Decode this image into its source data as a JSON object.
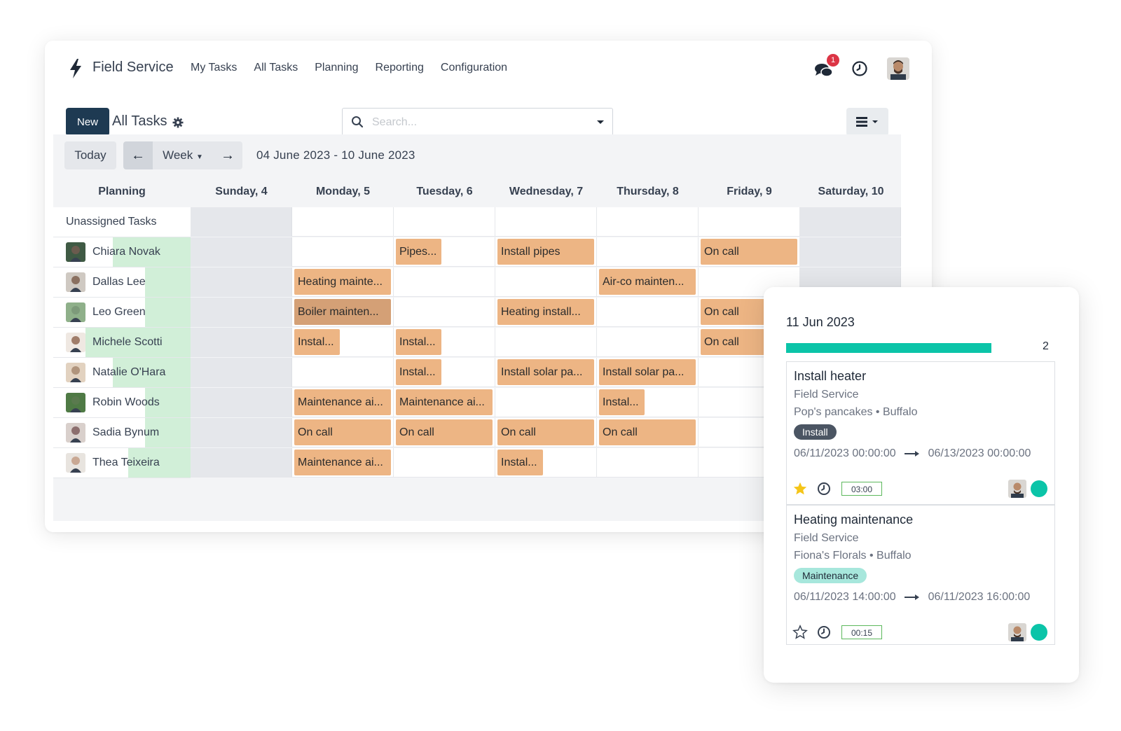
{
  "navbar": {
    "app_name": "Field Service",
    "menu": [
      "My Tasks",
      "All Tasks",
      "Planning",
      "Reporting",
      "Configuration"
    ],
    "chat_badge": "1",
    "icons": [
      "bolt-icon",
      "chat-icon",
      "clock-icon",
      "user-avatar"
    ]
  },
  "control": {
    "new_label": "New",
    "title": "All Tasks",
    "search_placeholder": "Search..."
  },
  "toolbar": {
    "today_label": "Today",
    "prev_label": "←",
    "scale_label": "Week",
    "next_label": "→",
    "date_range": "04 June 2023 - 10 June 2023"
  },
  "gantt": {
    "header": [
      "Planning",
      "Sunday, 4",
      "Monday, 5",
      "Tuesday, 6",
      "Wednesday, 7",
      "Thursday, 8",
      "Friday, 9",
      "Saturday, 10"
    ],
    "rows": [
      {
        "name": "Unassigned Tasks",
        "avatar": false,
        "green_fraction": 0,
        "tasks": []
      },
      {
        "name": "Chiara Novak",
        "avatar": true,
        "green_fraction": 0.65,
        "tasks": [
          {
            "day": 2,
            "span": 0.47,
            "label": "Pipes..."
          },
          {
            "day": 3,
            "span": 0.97,
            "label": "Install pipes"
          },
          {
            "day": 5,
            "span": 0.97,
            "label": "On call"
          }
        ]
      },
      {
        "name": "Dallas Lee",
        "avatar": true,
        "green_fraction": 0.38,
        "tasks": [
          {
            "day": 1,
            "span": 0.97,
            "label": "Heating mainte..."
          },
          {
            "day": 4,
            "span": 0.97,
            "label": "Air-co mainten..."
          }
        ]
      },
      {
        "name": "Leo Green",
        "avatar": true,
        "green_fraction": 0.38,
        "tasks": [
          {
            "day": 1,
            "span": 0.97,
            "label": "Boiler mainten...",
            "dark": true
          },
          {
            "day": 3,
            "span": 0.97,
            "label": "Heating install..."
          },
          {
            "day": 5,
            "span": 0.97,
            "label": "On call"
          }
        ]
      },
      {
        "name": "Michele Scotti",
        "avatar": true,
        "green_fraction": 0.88,
        "tasks": [
          {
            "day": 1,
            "span": 0.47,
            "label": "Instal..."
          },
          {
            "day": 2,
            "span": 0.47,
            "label": "Instal..."
          },
          {
            "day": 5,
            "span": 0.97,
            "label": "On call"
          }
        ]
      },
      {
        "name": "Natalie O'Hara",
        "avatar": true,
        "green_fraction": 0.65,
        "tasks": [
          {
            "day": 2,
            "span": 0.47,
            "label": "Instal..."
          },
          {
            "day": 3,
            "span": 0.97,
            "label": "Install solar pa..."
          },
          {
            "day": 4,
            "span": 0.97,
            "label": "Install solar pa..."
          }
        ]
      },
      {
        "name": "Robin Woods",
        "avatar": true,
        "green_fraction": 0.38,
        "tasks": [
          {
            "day": 1,
            "span": 0.97,
            "label": "Maintenance ai..."
          },
          {
            "day": 2,
            "span": 0.97,
            "label": "Maintenance ai..."
          },
          {
            "day": 4,
            "span": 0.47,
            "label": "Instal..."
          }
        ]
      },
      {
        "name": "Sadia Bynum",
        "avatar": true,
        "green_fraction": 0.38,
        "tasks": [
          {
            "day": 1,
            "span": 0.97,
            "label": "On call"
          },
          {
            "day": 2,
            "span": 0.97,
            "label": "On call"
          },
          {
            "day": 3,
            "span": 0.97,
            "label": "On call"
          },
          {
            "day": 4,
            "span": 0.97,
            "label": "On call"
          }
        ]
      },
      {
        "name": "Thea Teixeira",
        "avatar": true,
        "green_fraction": 0.52,
        "tasks": [
          {
            "day": 1,
            "span": 0.97,
            "label": "Maintenance ai..."
          },
          {
            "day": 3,
            "span": 0.47,
            "label": "Instal..."
          }
        ]
      }
    ]
  },
  "popover": {
    "date": "11 Jun 2023",
    "count": "2",
    "progress_fraction": 0.75,
    "cards": [
      {
        "title": "Install heater",
        "project": "Field Service",
        "location": "Pop's pancakes • Buffalo",
        "tag": "Install",
        "tag_style": "dark",
        "start": "06/11/2023 00:00:00",
        "end": "06/13/2023 00:00:00",
        "starred": true,
        "duration": "03:00"
      },
      {
        "title": "Heating maintenance",
        "project": "Field Service",
        "location": "Fiona's Florals • Buffalo",
        "tag": "Maintenance",
        "tag_style": "teal",
        "start": "06/11/2023 14:00:00",
        "end": "06/11/2023 16:00:00",
        "starred": false,
        "duration": "00:15"
      }
    ]
  },
  "colors": {
    "primary": "#1e3a52",
    "task": "#edb584",
    "task_dark": "#d4a076",
    "assigned": "#d1efd8",
    "accent": "#0bc4a8",
    "badge": "#dc3545"
  }
}
